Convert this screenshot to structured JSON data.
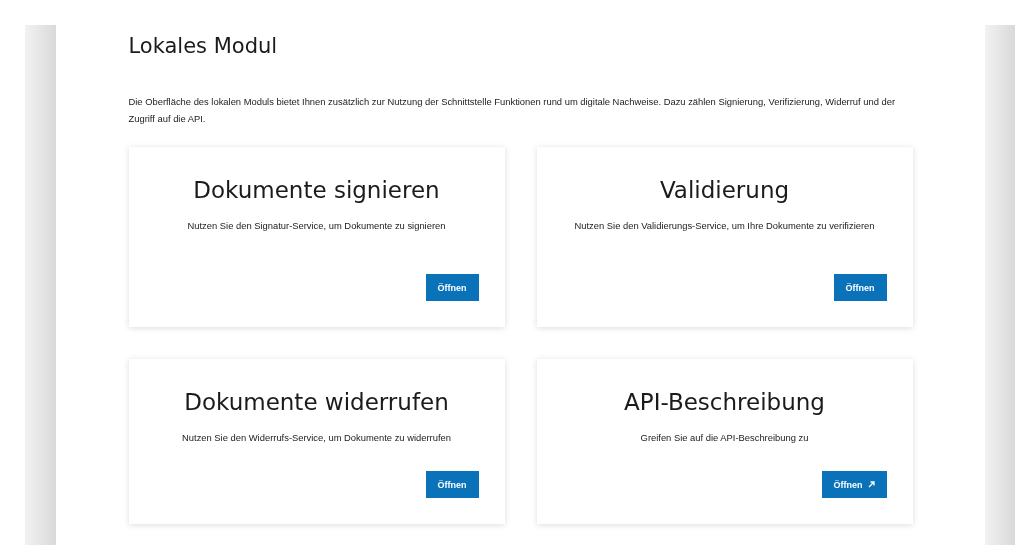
{
  "page": {
    "title": "Lokales Modul",
    "intro": "Die Oberfläche des lokalen Moduls bietet Ihnen zusätzlich zur Nutzung der Schnittstelle Funktionen rund um digitale Nachweise. Dazu zählen Signierung, Verifizierung, Widerruf und der Zugriff auf die API."
  },
  "cards": [
    {
      "title": "Dokumente signieren",
      "description": "Nutzen Sie den Signatur-Service, um Dokumente zu signieren",
      "button": "Öffnen",
      "external": false
    },
    {
      "title": "Validierung",
      "description": "Nutzen Sie den Validierungs-Service, um Ihre Dokumente zu verifizieren",
      "button": "Öffnen",
      "external": false
    },
    {
      "title": "Dokumente widerrufen",
      "description": "Nutzen Sie den Widerrufs-Service, um Dokumente zu widerrufen",
      "button": "Öffnen",
      "external": false
    },
    {
      "title": "API-Beschreibung",
      "description": "Greifen Sie auf die API-Beschreibung zu",
      "button": "Öffnen",
      "external": true
    }
  ]
}
